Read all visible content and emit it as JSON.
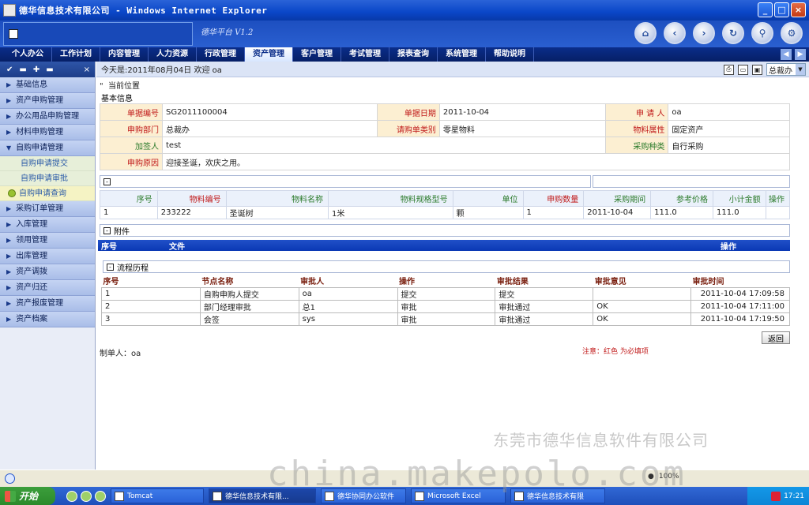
{
  "window": {
    "title": "德华信息技术有限公司 - Windows Internet Explorer"
  },
  "header": {
    "brand": "德华平台 V1.2",
    "icons": [
      "home-icon",
      "back-icon",
      "forward-icon",
      "refresh-icon",
      "search-icon",
      "settings-icon"
    ]
  },
  "nav": {
    "tabs": [
      "个人办公",
      "工作计划",
      "内容管理",
      "人力资源",
      "行政管理",
      "资产管理",
      "客户管理",
      "考试管理",
      "报表查询",
      "系统管理",
      "帮助说明"
    ],
    "active": "资产管理"
  },
  "sidebar": {
    "items": [
      "基础信息",
      "资产申购管理",
      "办公用品申购管理",
      "材料申购管理",
      "自购申请管理",
      "采购订单管理",
      "入库管理",
      "领用管理",
      "出库管理",
      "资产调拨",
      "资产归还",
      "资产报废管理",
      "资产档案"
    ],
    "subitems": [
      "自购申请提交",
      "自购申请审批",
      "自购申请查询"
    ]
  },
  "main": {
    "today": "今天是:2011年08月04日 欢迎 oa",
    "dept": "总裁办",
    "crumb": "当前位置",
    "section": "基本信息",
    "info": {
      "labels": [
        "单据编号",
        "单据日期",
        "申 请 人",
        "申购部门",
        "请购单类别",
        "物料属性",
        "加签人",
        "采购种类",
        "申购原因"
      ],
      "values": [
        "SG2011100004",
        "2011-10-04",
        "oa",
        "总裁办",
        "零星物料",
        "固定资产",
        "test",
        "自行采购",
        "迎接圣诞，欢庆之用。"
      ]
    },
    "items": {
      "headers": [
        "序号",
        "物料编号",
        "物料名称",
        "物料规格型号",
        "单位",
        "申购数量",
        "采购期间",
        "参考价格",
        "小计金额",
        "操作"
      ],
      "rows": [
        [
          "1",
          "233222",
          "圣诞树",
          "1米",
          "颗",
          "1",
          "2011-10-04",
          "111.0",
          "111.0",
          ""
        ]
      ]
    },
    "attach": {
      "title": "附件",
      "headers": [
        "序号",
        "文件",
        "操作"
      ]
    },
    "flow": {
      "title": "流程历程",
      "headers": [
        "序号",
        "节点名称",
        "审批人",
        "操作",
        "审批结果",
        "审批意见",
        "审批时间"
      ],
      "rows": [
        [
          "1",
          "自购申购人提交",
          "oa",
          "提交",
          "提交",
          "",
          "2011-10-04 17:09:58"
        ],
        [
          "2",
          "部门经理审批",
          "总1",
          "审批",
          "审批通过",
          "OK",
          "2011-10-04 17:11:00"
        ],
        [
          "3",
          "会签",
          "sys",
          "审批",
          "审批通过",
          "OK",
          "2011-10-04 17:19:50"
        ]
      ]
    },
    "return_label": "返回",
    "maker": "制单人：oa",
    "note": "注意：红色 为必填项"
  },
  "watermark": {
    "company": "东莞市德华信息软件有限公司",
    "site": "china.makepolo.com"
  },
  "taskbar": {
    "start": "开始",
    "tasks": [
      "Tomcat",
      "德华信息技术有限...",
      "德华协同办公软件",
      "Microsoft Excel",
      "德华信息技术有限"
    ],
    "clock": "17:21"
  },
  "statusbar": {
    "zoom": "100%"
  }
}
